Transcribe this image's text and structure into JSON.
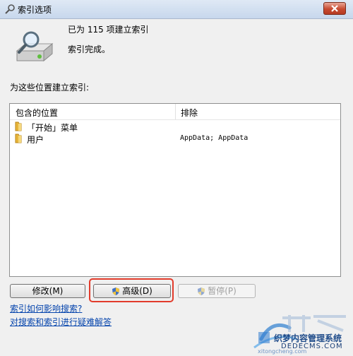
{
  "window": {
    "title": "索引选项",
    "close_icon": "close-icon",
    "title_icon": "indexing-options-icon"
  },
  "status": {
    "line1": "已为 115 项建立索引",
    "line2": "索引完成。",
    "icon": "drive-magnifier-icon"
  },
  "locations": {
    "label": "为这些位置建立索引:",
    "columns": [
      "包含的位置",
      "排除"
    ],
    "rows": [
      {
        "name": "「开始」菜单",
        "exclude": "",
        "icon": "folder-icon"
      },
      {
        "name": "用户",
        "exclude": "AppData; AppData",
        "icon": "folder-icon"
      }
    ]
  },
  "buttons": {
    "modify": "修改(M)",
    "advanced": "高级(D)",
    "pause": "暂停(P)"
  },
  "links": {
    "how_indexing": "索引如何影响搜索?",
    "troubleshoot": "对搜索和索引进行疑难解答"
  },
  "watermark": {
    "text1": "织梦内容管理系统",
    "text2": "DEDECMS.COM",
    "text3": "xitongcheng.com"
  },
  "colors": {
    "highlight_box": "#e23b2b",
    "link": "#0645ad",
    "close_button": "#c74a30"
  }
}
